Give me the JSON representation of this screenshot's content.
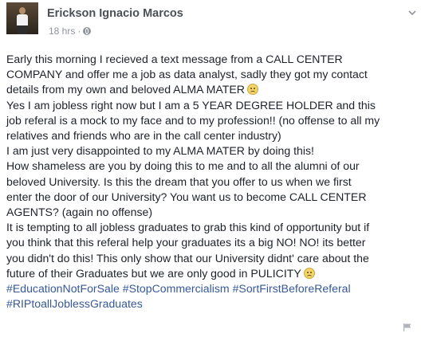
{
  "post": {
    "author": "Erickson Ignacio Marcos",
    "timestamp": "18 hrs",
    "separator": "·",
    "privacy_icon": "globe-icon",
    "menu_icon": "chevron-down-icon",
    "report_icon": "flag-icon",
    "emoji_icon": "frowning-face-emoji",
    "lines": [
      "Early this morning I recieved a text message from a CALL CENTER",
      "COMPANY and offer me a job as data analyst, sadly they got my contact",
      "details from my own and beloved ALMA MATER",
      "Yes I am jobless right now but I am a 5 YEAR DEGREE HOLDER and this",
      "job referal is a mock to my face and to my profession!! (no offense to all my",
      "relatives and friends who are in the call center industry)",
      "I am just very disappointed to my ALMA MATER by doing this!",
      "How shameless are you by doing this to me and to all the alumni of our",
      "beloved University. Is this the dream that you offer to us when we first",
      "enter the door of our University? You want us to become CALL CENTER",
      "AGENTS? (again no offense)",
      "It is tempting to all jobless graduates to grab this kind of opportunity but if",
      "you think that this referal help your graduates its a big NO! NO! its better",
      "you didn't do this! This only show that our University didnt' care about the",
      "future of their Graduates but we are only good in PULICITY"
    ],
    "hashtags_line1": [
      "#EducationNotForSale",
      "#StopCommercialism",
      "#SortFirstBeforeReferal"
    ],
    "hashtags_line2": [
      "#RIPtoallJoblessGraduates"
    ]
  },
  "colors": {
    "author": "#4b4f56",
    "meta": "#90949c",
    "text": "#1d2129",
    "hashtag": "#365899",
    "background": "#ffffff"
  }
}
